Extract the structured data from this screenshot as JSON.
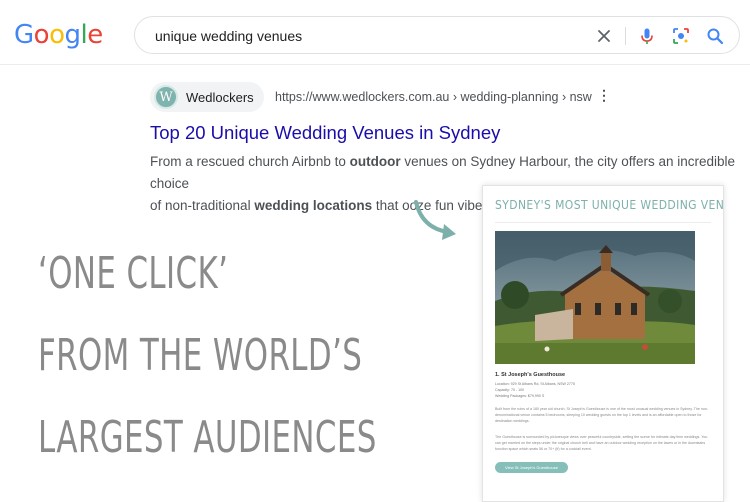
{
  "search": {
    "logo_letters": [
      "G",
      "o",
      "o",
      "g",
      "l",
      "e"
    ],
    "query": "unique wedding venues",
    "icons": [
      "close-icon",
      "microphone-icon",
      "lens-icon",
      "search-icon"
    ]
  },
  "result": {
    "site_name": "Wedlockers",
    "favicon_letter": "W",
    "url": "https://www.wedlockers.com.au › wedding-planning › nsw",
    "menu_glyph": "⋮",
    "title": "Top 20 Unique Wedding Venues in Sydney",
    "snippet_line1_a": "From a rescued church Airbnb to ",
    "snippet_line1_b": "outdoor",
    "snippet_line1_c": " venues on Sydney Harbour, the city offers an incredible choice",
    "snippet_line2_a": "of non-traditional ",
    "snippet_line2_b": "wedding locations",
    "snippet_line2_c": " that ooze fun vibes."
  },
  "preview": {
    "title": "SYDNEY'S MOST UNIQUE WEDDING VENUES",
    "item_title": "1. St Joseph's Guesthouse",
    "list": [
      "Location: 929 St Albans Rd, St Albans, NSW 2775",
      "Capacity: 70 - 100",
      "Wedding Packages: $79,990 S"
    ],
    "para1": "Built from the ruins of a 180 year old church, St Joseph's Guesthouse is one of the most unusual wedding venues in Sydney. The non-denominational venue contains 5 bedrooms, sleeping 10 wedding guests on the top 1 levels and is an affordable open to those for destination weddings.",
    "para2": "The Guesthouse is surrounded by picturesque views over peaceful countryside, setting the scene for intimate day time weddings. You can get married on the steps under the original church bell and have an outdoor wedding reception on the lawns or in the downstairs function space which seats 56 or 70+ (tf) for a cocktail event.",
    "button": "View St Joseph's Guesthouse"
  },
  "slogan": [
    "‘ONE CLICK’",
    "FROM THE WORLD’S",
    "LARGEST AUDIENCES"
  ],
  "colors": {
    "logo": [
      "#4285F4",
      "#EA4335",
      "#FBBC05",
      "#4285F4",
      "#34A853",
      "#EA4335"
    ],
    "link": "#1a0dab",
    "accent": "#7db0ab",
    "slogan": "#8a8a8a"
  }
}
